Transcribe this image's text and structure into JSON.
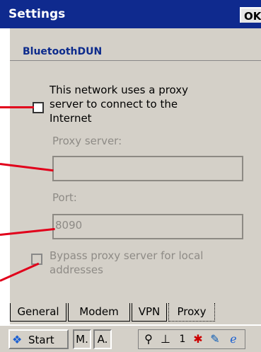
{
  "titlebar": {
    "title": "Settings",
    "ok_label": "OK"
  },
  "header": {
    "connection_name": "BluetoothDUN"
  },
  "proxy": {
    "checkbox_label_line1": "This network uses a proxy",
    "checkbox_label_line2": "server to connect to the",
    "checkbox_label_line3": "Internet",
    "proxy_server_label": "Proxy server:",
    "proxy_server_value": "",
    "port_label": "Port:",
    "port_value": "8090",
    "bypass_label_line1": "Bypass proxy server for local",
    "bypass_label_line2": "addresses"
  },
  "tabs": [
    {
      "label": "General"
    },
    {
      "label": "Modem"
    },
    {
      "label": "VPN"
    },
    {
      "label": "Proxy"
    }
  ],
  "taskbar": {
    "start_label": "Start",
    "input_mode_1": "M.",
    "input_mode_2": "A.",
    "tray_number": "1"
  },
  "icons": [
    "windows-flag-icon",
    "network-icon",
    "usb-icon",
    "bluetooth-icon",
    "edit-icon",
    "ie-icon"
  ],
  "colors": {
    "titlebar": "#0f2a8e",
    "accent_red": "#e1001b",
    "panel": "#d4d0c8",
    "header_text": "#0d2b8c"
  }
}
